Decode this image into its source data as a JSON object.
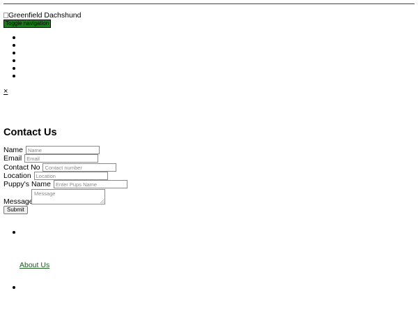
{
  "header": {
    "logo_alt": "Greenfield Dachshund",
    "toggle_label": "Toggle navigation",
    "menu_items": [
      "",
      "",
      "",
      "",
      "",
      ""
    ],
    "close_symbol": "×"
  },
  "contact": {
    "title": "Contact Us",
    "fields": {
      "name": {
        "label": "Name",
        "placeholder": "Name",
        "value": ""
      },
      "email": {
        "label": "Email",
        "placeholder": "Email",
        "value": ""
      },
      "contact": {
        "label": "Contact No",
        "placeholder": "Contact number",
        "value": ""
      },
      "location": {
        "label": "Location",
        "placeholder": "Location",
        "value": ""
      },
      "puppy": {
        "label": "Puppy's Name",
        "placeholder": "Enter Pups Name",
        "value": ""
      },
      "message": {
        "label": "Message",
        "placeholder": "Message",
        "value": ""
      }
    },
    "submit_label": "Submit"
  },
  "footer": {
    "about_label": "About Us"
  },
  "colors": {
    "accent_green": "#1b5e20",
    "button_green": "#1b7a1b"
  }
}
